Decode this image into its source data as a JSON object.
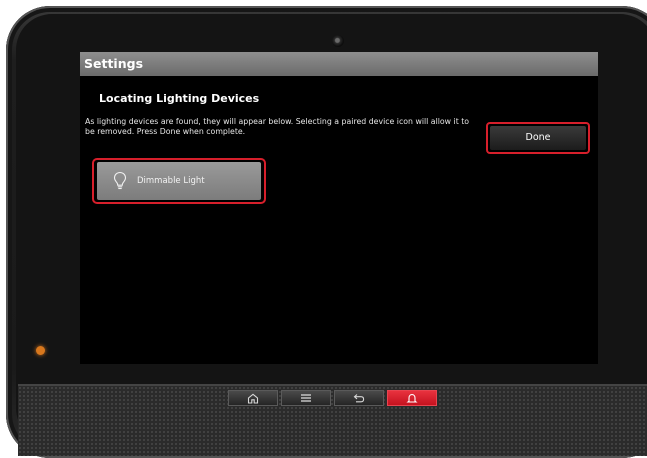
{
  "titlebar": {
    "title": "Settings"
  },
  "main": {
    "heading": "Locating Lighting Devices",
    "description": "As lighting devices are found, they will appear below.  Selecting a paired device icon will allow it to be removed.  Press Done when complete.",
    "done_label": "Done",
    "devices": [
      {
        "label": "Dimmable Light",
        "icon": "lightbulb-icon"
      }
    ]
  },
  "navbar": {
    "buttons": [
      "home-icon",
      "menu-icon",
      "back-icon",
      "alarm-bell-icon"
    ]
  },
  "colors": {
    "highlight": "#d71f2b",
    "titlebar": "#7a7a7a",
    "screen_bg": "#000000",
    "led": "#d8771d",
    "alert_button": "#d91a27"
  }
}
